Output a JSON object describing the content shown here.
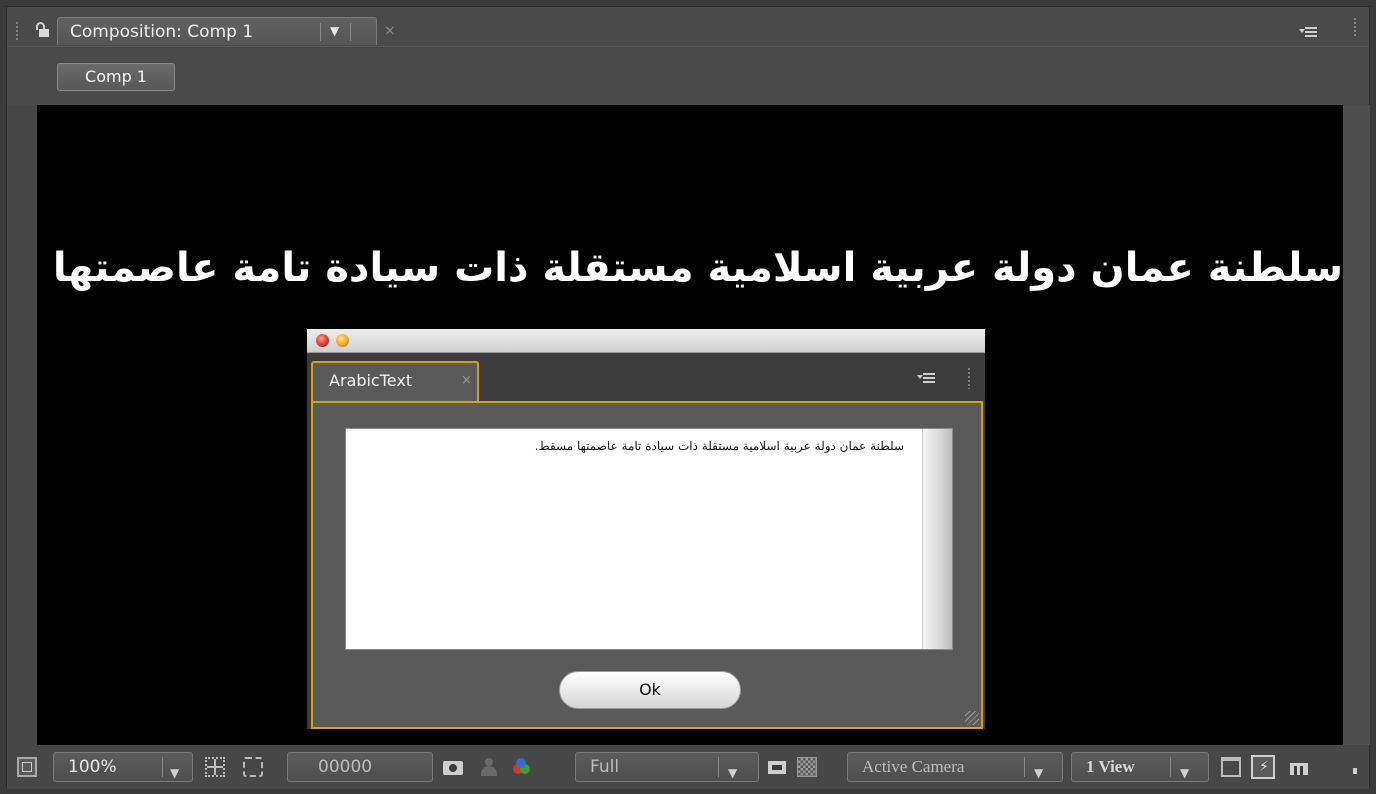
{
  "tab": {
    "title": "Composition: Comp 1",
    "close": "×"
  },
  "breadcrumb": {
    "label": "Comp 1"
  },
  "viewer": {
    "arabic_text": "سلطنة عمان دولة عربية اسلامية مستقلة ذات سيادة تامة عاصمتها مسقط."
  },
  "dialog": {
    "tab_title": "ArabicText",
    "tab_close": "×",
    "text_value": "سلطنة عمان دولة عربية اسلامية مستقلة ذات سيادة تامة عاصمتها مسقط.",
    "ok_label": "Ok"
  },
  "toolbar": {
    "magnification": "100%",
    "timecode": "00000",
    "resolution": "Full",
    "camera": "Active Camera",
    "views": "1 View"
  },
  "icons": [
    "lock-icon",
    "panel-menu-icon",
    "show-channel-icon",
    "snapshot-icon",
    "color-channels-icon"
  ]
}
